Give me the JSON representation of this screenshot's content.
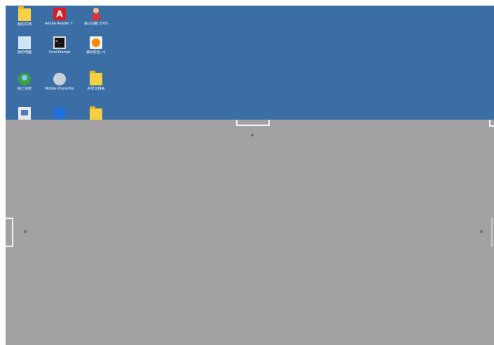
{
  "desktop": {
    "icons": [
      {
        "label": "我的文档",
        "icon": "folder-icon"
      },
      {
        "label": "Adobe Reader 7.0",
        "icon": "acrobat-icon"
      },
      {
        "label": "金山词霸 2005",
        "icon": "person-icon"
      },
      {
        "label": "我的电脑",
        "icon": "monitor-icon"
      },
      {
        "label": "Cmd Prompt",
        "icon": "console-icon"
      },
      {
        "label": "暴风影音 v1",
        "icon": "media-player-icon"
      },
      {
        "label": "网上邻居",
        "icon": "network-globe-icon"
      },
      {
        "label": "Mobile PhoneTools",
        "icon": "phone-tools-icon"
      },
      {
        "label": "共享文档夹",
        "icon": "folder-icon"
      },
      {
        "label": "",
        "icon": "computer-icon"
      },
      {
        "label": "",
        "icon": "info-circle-icon"
      },
      {
        "label": "",
        "icon": "folder-icon"
      }
    ]
  },
  "colors": {
    "wallpaper": "#3a6ea5",
    "overlay": "#a3a1a4",
    "handle": "#f4f4f4"
  }
}
